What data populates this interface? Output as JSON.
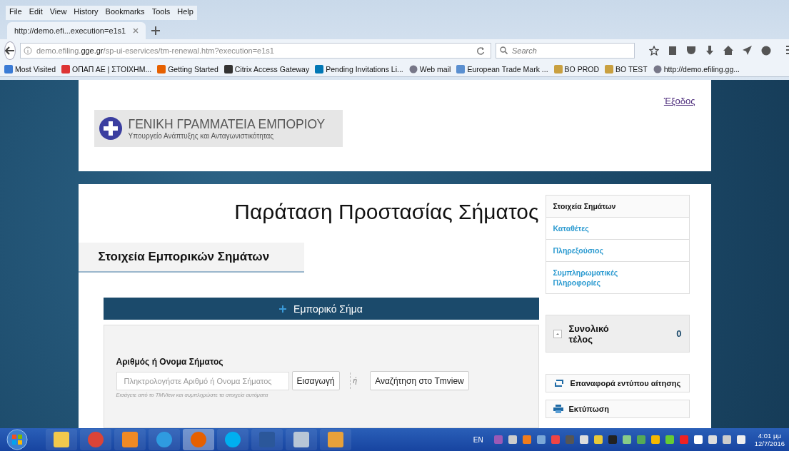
{
  "menu_bar": [
    "File",
    "Edit",
    "View",
    "History",
    "Bookmarks",
    "Tools",
    "Help"
  ],
  "tabs": [
    {
      "label": "http://demo.efi...execution=e1s1",
      "selected": true
    }
  ],
  "address_bar": {
    "url_prefix": "demo.efiling.",
    "url_domain": "gge.gr",
    "url_path": "/sp-ui-eservices/tm-renewal.htm?execution=e1s1"
  },
  "search": {
    "placeholder": "Search"
  },
  "bookmarks": [
    {
      "label": "Most Visited",
      "kind": "folder"
    },
    {
      "label": "ΟΠΑΠ ΑΕ | ΣΤΟΙΧΗΜ...",
      "kind": "star"
    },
    {
      "label": "Getting Started",
      "kind": "fox"
    },
    {
      "label": "Citrix Access Gateway",
      "kind": "dark"
    },
    {
      "label": "Pending Invitations  Li...",
      "kind": "in"
    },
    {
      "label": "Web mail",
      "kind": "globe"
    },
    {
      "label": "European Trade Mark ...",
      "kind": "drop"
    },
    {
      "label": "BO PROD",
      "kind": "chart"
    },
    {
      "label": "BO TEST",
      "kind": "chart"
    },
    {
      "label": "http://demo.efiling.gg...",
      "kind": "globe"
    }
  ],
  "page": {
    "logo_title": "ΓΕΝΙΚΗ ΓΡΑΜΜΑΤΕΙΑ ΕΜΠΟΡΙΟΥ",
    "logo_subtitle": "Υπουργείο Ανάπτυξης και Ανταγωνιστικότητας",
    "logout": "Έξοδος",
    "heading": "Παράταση Προστασίας Σήματος",
    "side_nav": [
      {
        "label": "Στοιχεία Σημάτων",
        "selected": true
      },
      {
        "label": "Καταθέτες",
        "selected": false
      },
      {
        "label": "Πληρεξούσιος",
        "selected": false
      },
      {
        "label": "Συμπληρωματικές Πληροφορίες",
        "selected": false
      }
    ],
    "section_title": "Στοιχεία Εμπορικών Σημάτων",
    "panel_header": "Εμπορικό Σήμα",
    "field_label": "Αριθμός ή Ονομα Σήματος",
    "field_placeholder": "Πληκτρολογήστε Αριθμό ή Ονομα Σήματος",
    "insert_button": "Εισαγωγή",
    "or_text": "ή",
    "tmview_button": "Αναζήτηση στο Tmview",
    "hint": "Εισάγετε από το TMView και συμπληρώστε τα στοιχεία αυτόματα",
    "total_label": "Συνολικό τέλος",
    "total_value": "0",
    "actions": [
      {
        "label": "Επαναφορά εντύπου αίτησης",
        "kind": "reset"
      },
      {
        "label": "Εκτύπωση",
        "kind": "print"
      }
    ]
  },
  "taskbar": {
    "apps": [
      {
        "kind": "folder",
        "selected": false
      },
      {
        "kind": "chrome",
        "selected": false
      },
      {
        "kind": "player",
        "selected": false
      },
      {
        "kind": "ie",
        "selected": false
      },
      {
        "kind": "firefox",
        "selected": true
      },
      {
        "kind": "skype",
        "selected": false
      },
      {
        "kind": "word",
        "selected": false
      },
      {
        "kind": "calc",
        "selected": false
      },
      {
        "kind": "outlook",
        "selected": false
      }
    ],
    "language": "EN",
    "time": "4:01 μμ",
    "date": "12/7/2016"
  }
}
